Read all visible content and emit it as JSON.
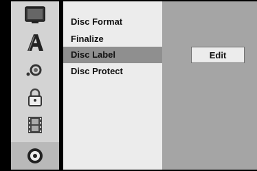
{
  "menu": {
    "items": [
      {
        "label": "Disc Format",
        "highlighted": false
      },
      {
        "label": "Finalize",
        "highlighted": false
      },
      {
        "label": "Disc Label",
        "highlighted": true
      },
      {
        "label": "Disc Protect",
        "highlighted": false
      }
    ]
  },
  "panel": {
    "edit_label": "Edit"
  },
  "icons": {
    "items": [
      {
        "name": "tv-icon"
      },
      {
        "name": "language-icon"
      },
      {
        "name": "audio-icon"
      },
      {
        "name": "lock-icon"
      },
      {
        "name": "film-icon"
      },
      {
        "name": "disc-icon",
        "selected": true
      }
    ]
  },
  "colors": {
    "icon_col_bg": "#d3d3d3",
    "menu_bg": "#ececec",
    "menu_highlight": "#8f8f8f",
    "panel_bg": "#a5a5a5"
  }
}
